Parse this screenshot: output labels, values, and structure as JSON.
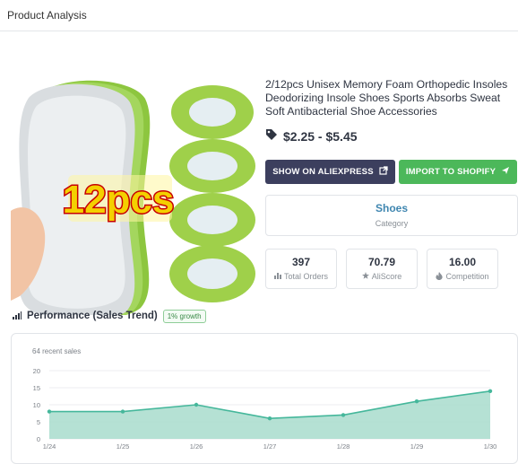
{
  "header": {
    "title": "Product Analysis"
  },
  "product": {
    "image_badge": "12pcs",
    "title": "2/12pcs Unisex Memory Foam Orthopedic Insoles Deodorizing Insole Shoes Sports Absorbs Sweat Soft Antibacterial Shoe Accessories",
    "price": "$2.25 - $5.45",
    "price_icon": "price-tag-icon"
  },
  "buttons": {
    "aliexpress": {
      "label": "SHOW ON ALIEXPRESS",
      "icon": "external-link-icon",
      "color": "#3c3f5e"
    },
    "shopify": {
      "label": "IMPORT TO SHOPIFY",
      "icon": "send-icon",
      "color": "#4cb85a"
    }
  },
  "category": {
    "value": "Shoes",
    "label": "Category"
  },
  "stats": [
    {
      "value": "397",
      "label": "Total Orders",
      "icon": "bar-chart-icon"
    },
    {
      "value": "70.79",
      "label": "AliScore",
      "icon": "star-icon"
    },
    {
      "value": "16.00",
      "label": "Competition",
      "icon": "fire-icon"
    }
  ],
  "performance": {
    "title": "Performance (Sales Trend)",
    "growth_badge": "1% growth"
  },
  "chart_data": {
    "type": "area",
    "title": "64 recent sales",
    "x": [
      "1/24",
      "1/25",
      "1/26",
      "1/27",
      "1/28",
      "1/29",
      "1/30"
    ],
    "series": [
      {
        "values": [
          8,
          8,
          10,
          6,
          7,
          11,
          14
        ]
      }
    ],
    "yticks": [
      0,
      5,
      10,
      15,
      20
    ],
    "ylim": [
      0,
      20
    ],
    "grid": true,
    "line_color": "#45b79b",
    "fill_color": "#a8dccd"
  }
}
